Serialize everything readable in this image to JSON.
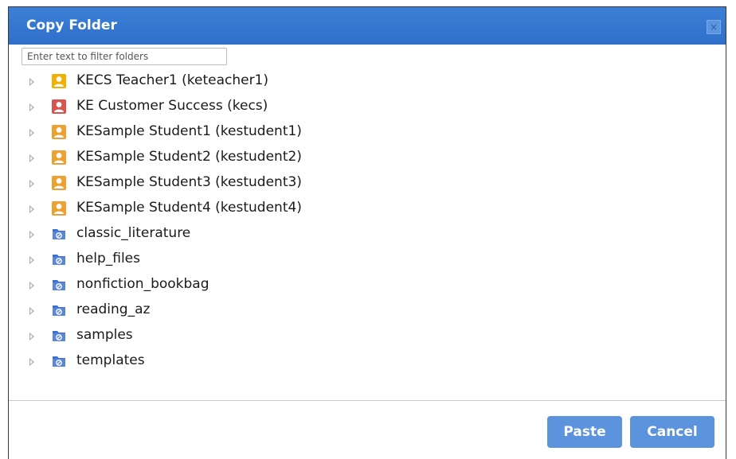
{
  "dialog": {
    "title": "Copy Folder",
    "close_icon": "close-icon",
    "close_symbol": "×"
  },
  "filter": {
    "placeholder": "Enter text to filter folders",
    "value": ""
  },
  "tree": {
    "items": [
      {
        "label": "KECS Teacher1 (keteacher1)",
        "icon": "user-icon",
        "color": "#f4b000"
      },
      {
        "label": "KE Customer Success (kecs)",
        "icon": "user-icon",
        "color": "#d9534f"
      },
      {
        "label": "KESample Student1 (kestudent1)",
        "icon": "user-icon",
        "color": "#f0a030"
      },
      {
        "label": "KESample Student2 (kestudent2)",
        "icon": "user-icon",
        "color": "#f0a030"
      },
      {
        "label": "KESample Student3 (kestudent3)",
        "icon": "user-icon",
        "color": "#f0a030"
      },
      {
        "label": "KESample Student4 (kestudent4)",
        "icon": "user-icon",
        "color": "#f0a030"
      },
      {
        "label": "classic_literature",
        "icon": "shared-folder-icon",
        "color": "#3f6fc9"
      },
      {
        "label": "help_files",
        "icon": "shared-folder-icon",
        "color": "#3f6fc9"
      },
      {
        "label": "nonfiction_bookbag",
        "icon": "shared-folder-icon",
        "color": "#3f6fc9"
      },
      {
        "label": "reading_az",
        "icon": "shared-folder-icon",
        "color": "#3f6fc9"
      },
      {
        "label": "samples",
        "icon": "shared-folder-icon",
        "color": "#3f6fc9"
      },
      {
        "label": "templates",
        "icon": "shared-folder-icon",
        "color": "#3f6fc9"
      }
    ]
  },
  "footer": {
    "paste_label": "Paste",
    "cancel_label": "Cancel"
  },
  "colors": {
    "titlebar": "#2f6fca",
    "button": "#5b93dc"
  }
}
